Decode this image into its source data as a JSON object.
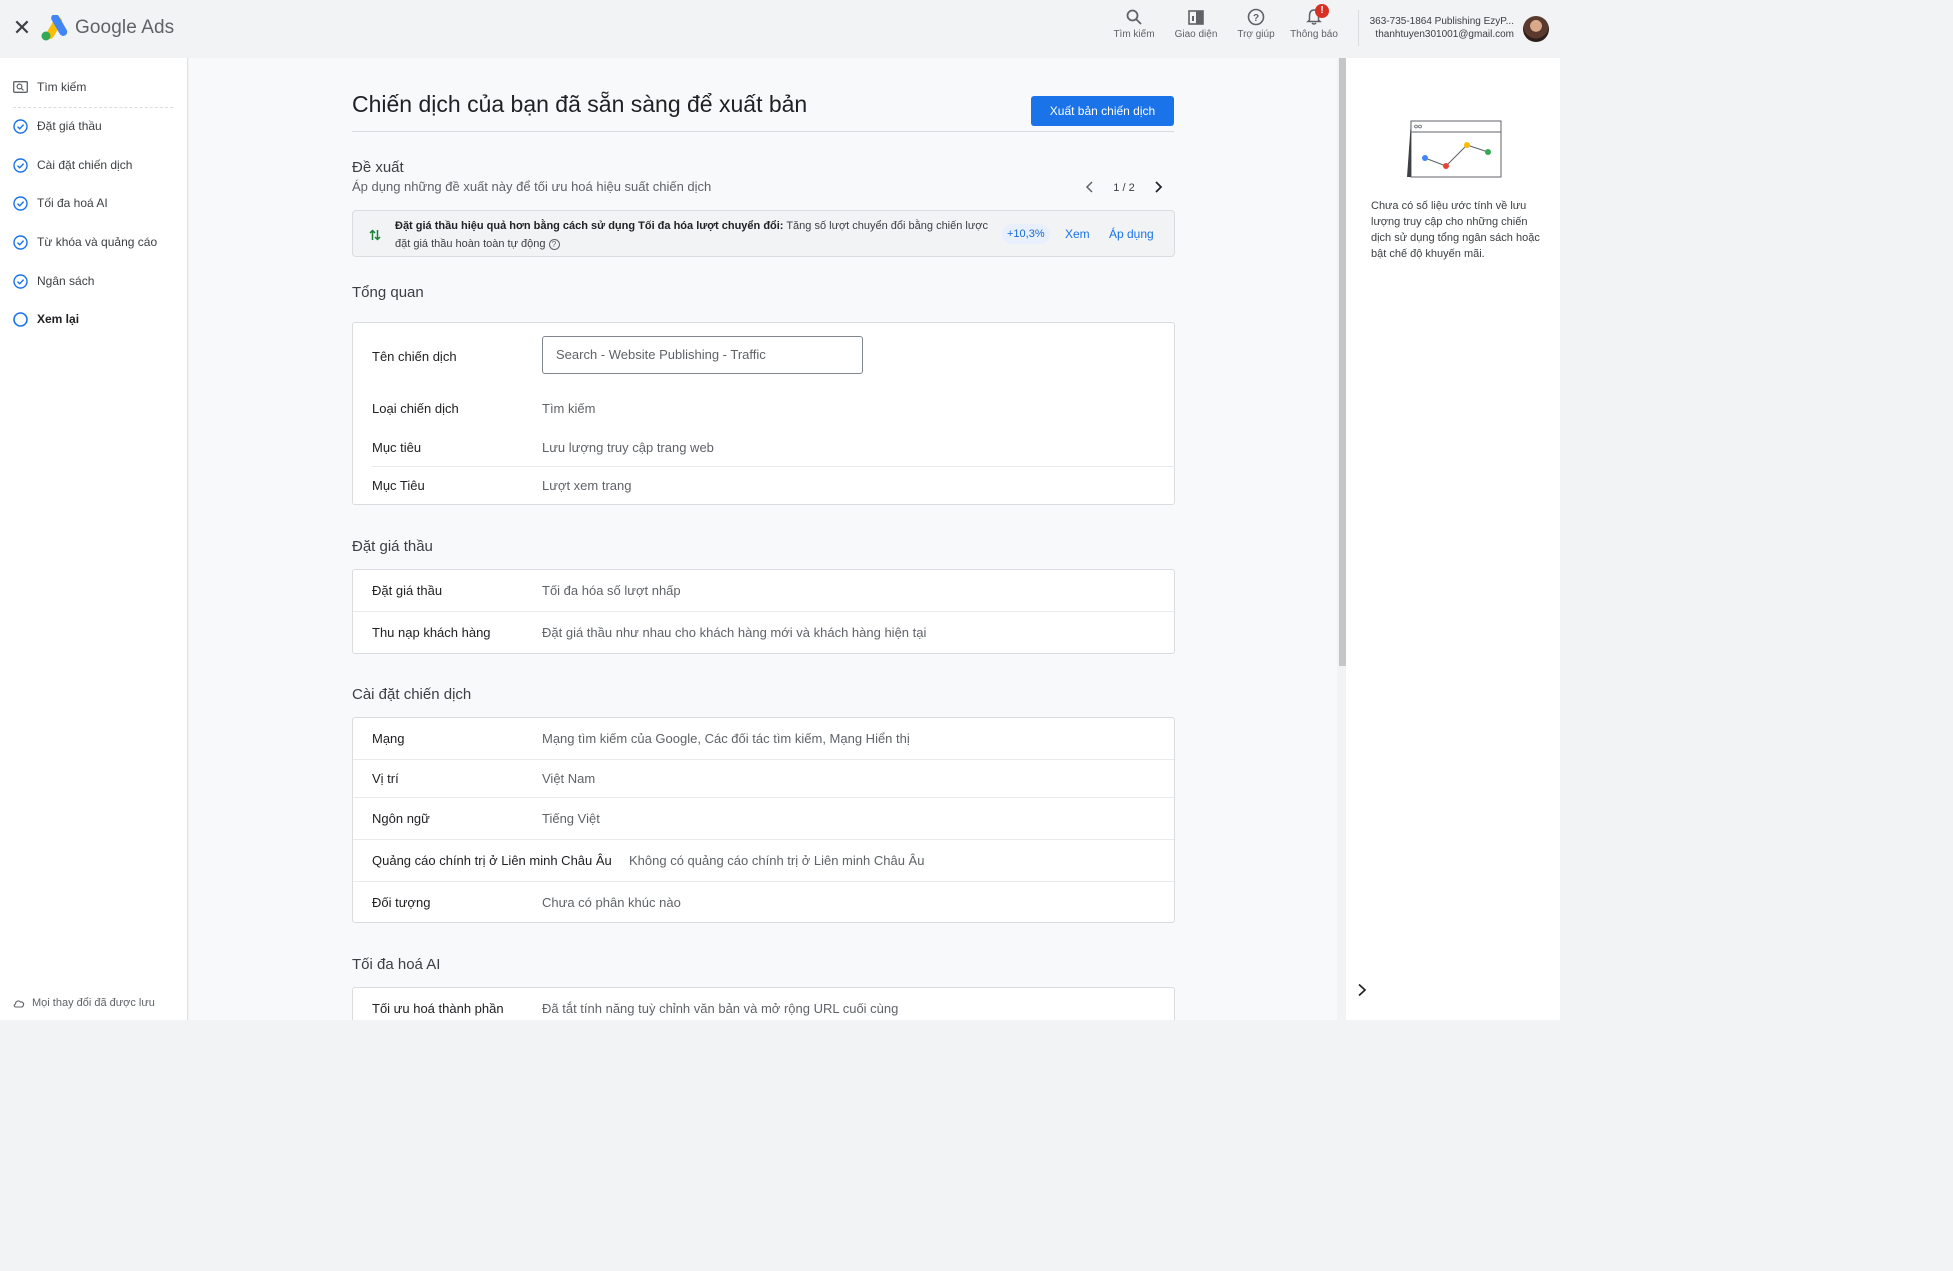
{
  "topbar": {
    "brand": "Google Ads",
    "buttons": [
      {
        "label": "Tìm kiếm",
        "icon": "search-icon"
      },
      {
        "label": "Giao diện",
        "icon": "appearance-icon"
      },
      {
        "label": "Trợ giúp",
        "icon": "help-icon"
      },
      {
        "label": "Thông báo",
        "icon": "bell-icon",
        "badge": "!"
      }
    ],
    "account_line1": "363-735-1864 Publishing EzyP...",
    "account_line2": "thanhtuyen301001@gmail.com"
  },
  "sidebar": {
    "items": [
      {
        "label": "Tìm kiếm",
        "icon": "search-campaign-icon",
        "state": "type"
      },
      {
        "label": "Đặt giá thầu",
        "icon": "check-circle-icon",
        "state": "done"
      },
      {
        "label": "Cài đặt chiến dịch",
        "icon": "check-circle-icon",
        "state": "done"
      },
      {
        "label": "Tối đa hoá AI",
        "icon": "check-circle-icon",
        "state": "done"
      },
      {
        "label": "Từ khóa và quảng cáo",
        "icon": "check-circle-icon",
        "state": "done"
      },
      {
        "label": "Ngân sách",
        "icon": "check-circle-icon",
        "state": "done"
      },
      {
        "label": "Xem lại",
        "icon": "circle-icon",
        "state": "current"
      }
    ],
    "saved_text": "Mọi thay đổi đã được lưu"
  },
  "main": {
    "title": "Chiến dịch của bạn đã sẵn sàng để xuất bản",
    "publish_label": "Xuất bản chiến dịch",
    "recommendations": {
      "heading": "Đề xuất",
      "subheading": "Áp dụng những đề xuất này để tối ưu hoá hiệu suất chiến dịch",
      "pager": "1 / 2",
      "item_bold": "Đặt giá thầu hiệu quả hơn bằng cách sử dụng Tối đa hóa lượt chuyển đổi:",
      "item_text": " Tăng số lượt chuyển đổi bằng chiến lược đặt giá thầu hoàn toàn tự động",
      "uplift": "+10,3%",
      "view_label": "Xem",
      "apply_label": "Áp dụng"
    },
    "overview": {
      "heading": "Tổng quan",
      "name_label": "Tên chiến dịch",
      "name_value": "Search - Website Publishing - Traffic",
      "type_label": "Loại chiến dịch",
      "type_value": "Tìm kiếm",
      "goal_label": "Mục tiêu",
      "goal_value": "Lưu lượng truy cập trang web",
      "goal2_label": "Mục Tiêu",
      "goal2_value": "Lượt xem trang"
    },
    "bidding": {
      "heading": "Đặt giá thầu",
      "rows": [
        {
          "label": "Đặt giá thầu",
          "value": "Tối đa hóa số lượt nhấp"
        },
        {
          "label": "Thu nạp khách hàng",
          "value": "Đặt giá thầu như nhau cho khách hàng mới và khách hàng hiện tại"
        }
      ]
    },
    "settings": {
      "heading": "Cài đặt chiến dịch",
      "rows": [
        {
          "label": "Mạng",
          "value": "Mạng tìm kiếm của Google, Các đối tác tìm kiếm, Mạng Hiển thị"
        },
        {
          "label": "Vị trí",
          "value": "Việt Nam"
        },
        {
          "label": "Ngôn ngữ",
          "value": "Tiếng Việt"
        },
        {
          "label": "Quảng cáo chính trị ở Liên minh Châu Âu",
          "value": "Không có quảng cáo chính trị ở Liên minh Châu Âu"
        },
        {
          "label": "Đối tượng",
          "value": "Chưa có phân khúc nào"
        }
      ]
    },
    "ai": {
      "heading": "Tối đa hoá AI",
      "rows": [
        {
          "label": "Tối ưu hoá thành phần",
          "value": "Đã tắt tính năng tuỳ chỉnh văn bản và mở rộng URL cuối cùng"
        }
      ]
    }
  },
  "right_panel": {
    "note": "Chưa có số liệu ước tính về lưu lượng truy cập cho những chiến dịch sử dụng tổng ngân sách hoặc bật chế độ khuyến mãi."
  },
  "colors": {
    "primary": "#1a73e8",
    "badge": "#d93025",
    "reco_arrow_up": "#188038"
  }
}
